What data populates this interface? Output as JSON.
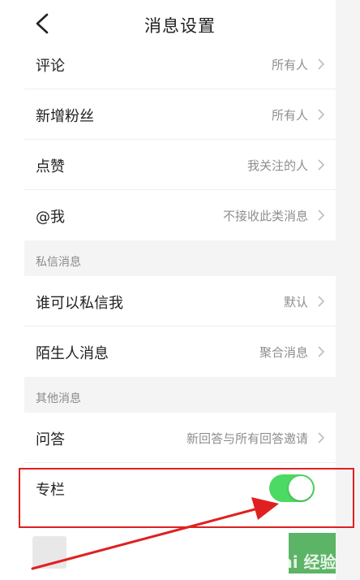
{
  "header": {
    "title": "消息设置",
    "back_icon": "chevron-left-icon"
  },
  "rows_top": [
    {
      "label": "评论",
      "value": "所有人"
    },
    {
      "label": "新增粉丝",
      "value": "所有人"
    },
    {
      "label": "点赞",
      "value": "我关注的人"
    },
    {
      "label": "@我",
      "value": "不接收此类消息"
    }
  ],
  "section_private": {
    "title": "私信消息",
    "rows": [
      {
        "label": "谁可以私信我",
        "value": "默认"
      },
      {
        "label": "陌生人消息",
        "value": "聚合消息"
      }
    ]
  },
  "section_other": {
    "title": "其他消息",
    "rows": [
      {
        "label": "问答",
        "value": "新回答与所有回答邀请"
      }
    ],
    "toggle_row": {
      "label": "专栏",
      "enabled": true
    }
  },
  "watermark": {
    "text": "Bai 经验"
  },
  "colors": {
    "toggle_on": "#4cd964",
    "highlight": "#e02020",
    "section_bg": "#f4f4f4"
  }
}
